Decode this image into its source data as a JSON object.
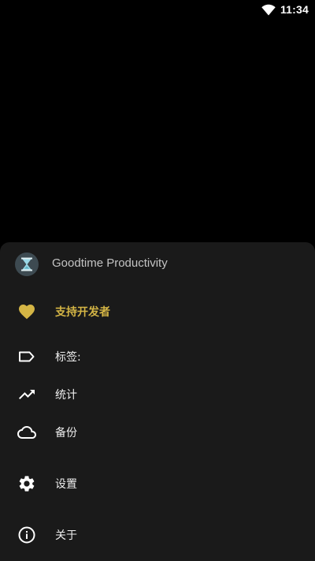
{
  "status_bar": {
    "time": "11:34",
    "wifi_icon": "wifi-icon"
  },
  "drawer": {
    "app_name": "Goodtime Productivity",
    "app_icon": "hourglass-icon",
    "items": [
      {
        "label": "支持开发者",
        "icon": "heart-icon",
        "color": "#d4b545"
      },
      {
        "label": "标签:",
        "icon": "label-tag-icon"
      },
      {
        "label": "统计",
        "icon": "trending-up-icon"
      },
      {
        "label": "备份",
        "icon": "cloud-icon"
      },
      {
        "label": "设置",
        "icon": "gear-icon"
      },
      {
        "label": "关于",
        "icon": "info-icon"
      }
    ]
  },
  "colors": {
    "background": "#000000",
    "sheet": "#1a1a1a",
    "accent": "#d4b545",
    "text": "#eeeeee"
  }
}
